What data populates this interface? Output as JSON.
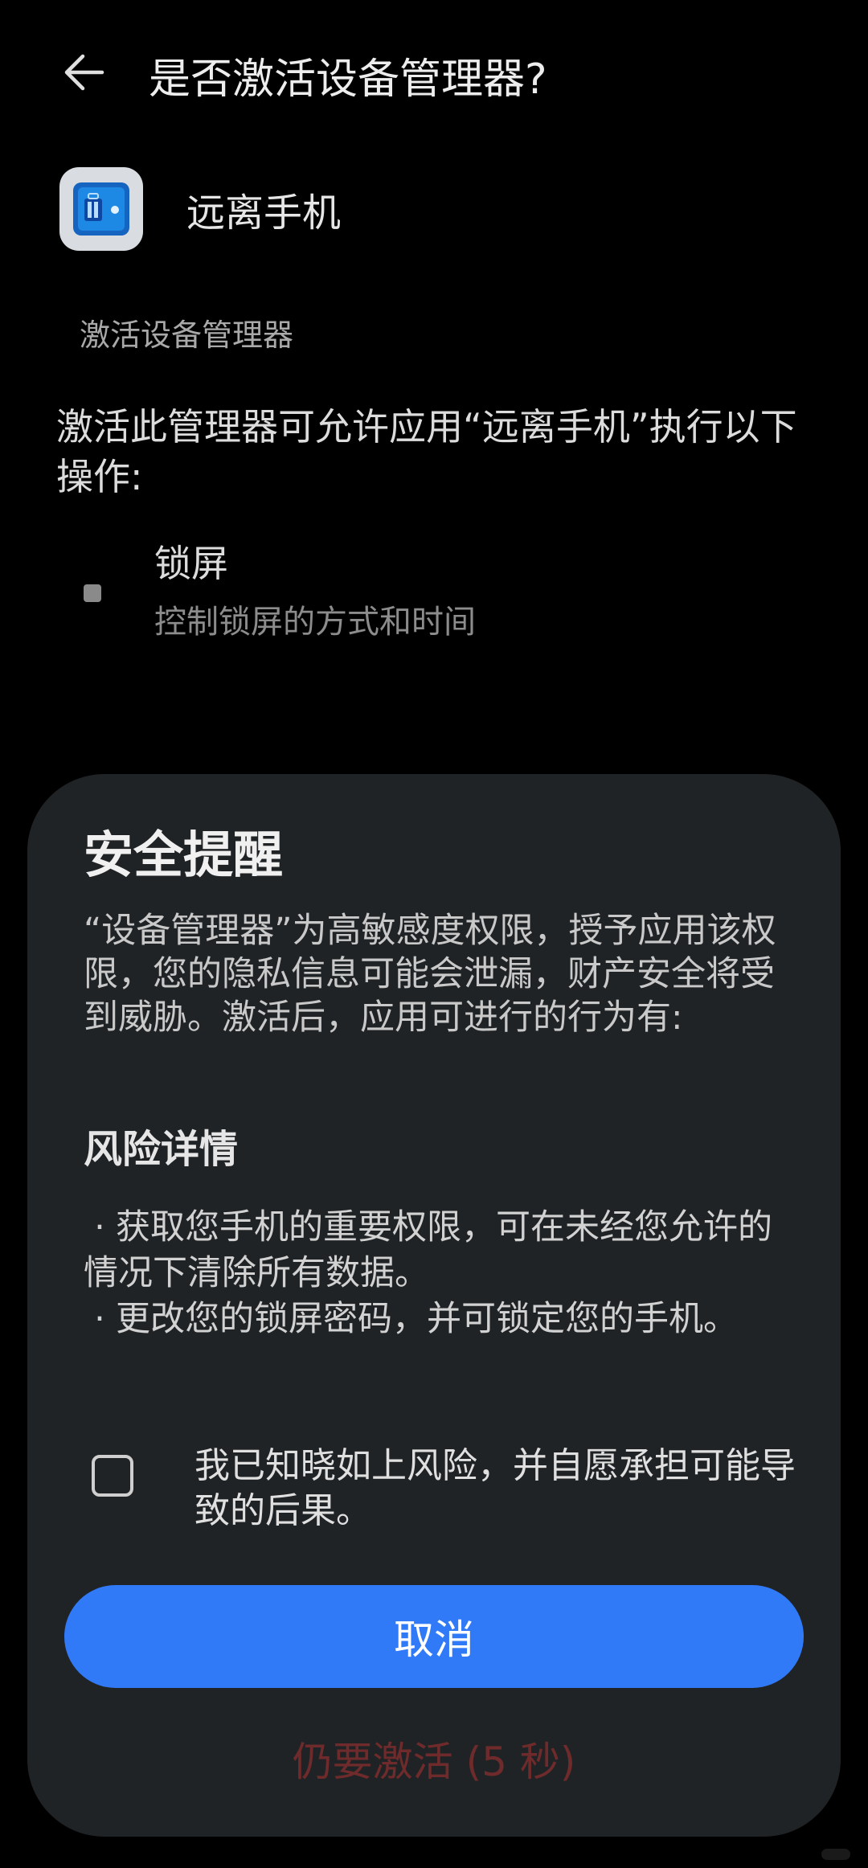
{
  "header": {
    "back_icon": "arrow-left-icon",
    "title": "是否激活设备管理器?"
  },
  "app": {
    "icon": "app-briefcase-icon",
    "name": "远离手机"
  },
  "section_label": "激活设备管理器",
  "permission_description": "激活此管理器可允许应用“远离手机”执行以下操作:",
  "permissions": [
    {
      "icon": "lock-screen-icon",
      "title": "锁屏",
      "subtitle": "控制锁屏的方式和时间"
    }
  ],
  "dialog": {
    "title": "安全提醒",
    "body": "“设备管理器”为高敏感度权限，授予应用该权限，您的隐私信息可能会泄漏，财产安全将受到威胁。激活后，应用可进行的行为有:",
    "risk_title": "风险详情",
    "risks": [
      "获取您手机的重要权限，可在未经您允许的情况下清除所有数据。",
      "更改您的锁屏密码，并可锁定您的手机。"
    ],
    "acknowledge_text": "我已知晓如上风险，并自愿承担可能导致的后果。",
    "acknowledge_checked": false,
    "cancel_label": "取消",
    "activate_label": "仍要激活 (5 秒)"
  },
  "colors": {
    "background": "#000000",
    "sheet": "#202325",
    "primary": "#317af7",
    "danger_disabled": "#6f2b2b"
  }
}
